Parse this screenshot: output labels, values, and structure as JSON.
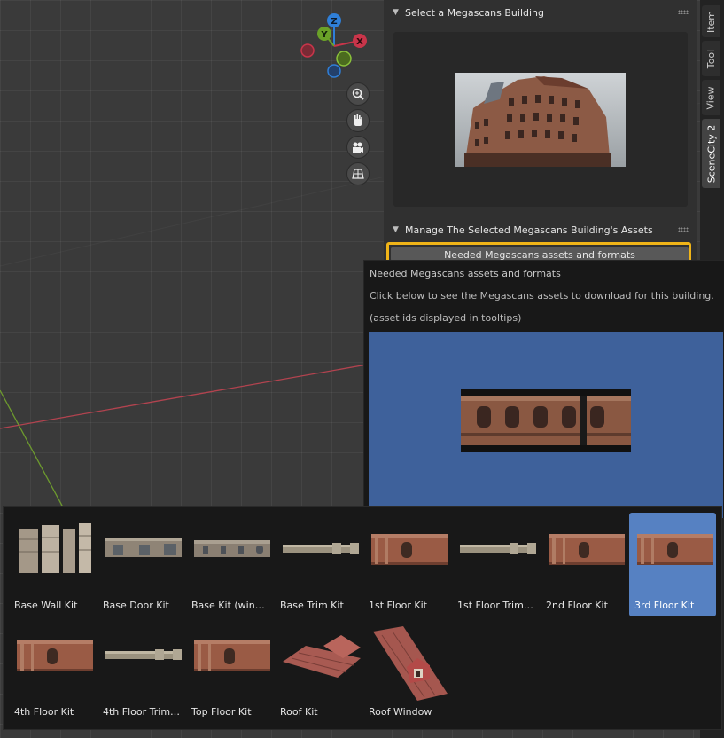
{
  "panel": {
    "section1_title": "Select a Megascans Building",
    "section2_title": "Manage The Selected Megascans Building's Assets",
    "button_label": "Needed Megascans assets and formats"
  },
  "tabs": [
    "Item",
    "Tool",
    "View",
    "SceneCity 2"
  ],
  "active_tab": "SceneCity 2",
  "tooltip": {
    "title": "Needed Megascans assets and formats",
    "description": "Click below to see the Megascans assets to download for this building.",
    "note": "(asset ids displayed in tooltips)"
  },
  "gizmo": {
    "z": "Z",
    "y": "Y",
    "x": "X"
  },
  "assets": [
    {
      "label": "Base Wall Kit",
      "icon": "wall-kit-thumbnail",
      "selected": false
    },
    {
      "label": "Base Door Kit",
      "icon": "door-kit-thumbnail",
      "selected": false
    },
    {
      "label": "Base Kit (wind…",
      "icon": "window-kit-thumbnail",
      "selected": false
    },
    {
      "label": "Base Trim Kit",
      "icon": "trim-kit-thumbnail",
      "selected": false
    },
    {
      "label": "1st Floor Kit",
      "icon": "floor-kit-thumbnail",
      "selected": false
    },
    {
      "label": "1st Floor Trim Kit",
      "icon": "trim-kit-thumbnail",
      "selected": false
    },
    {
      "label": "2nd Floor Kit",
      "icon": "floor-kit-thumbnail",
      "selected": false
    },
    {
      "label": "3rd Floor Kit",
      "icon": "floor-kit-thumbnail",
      "selected": true
    },
    {
      "label": "4th Floor Kit",
      "icon": "floor-kit-thumbnail",
      "selected": false
    },
    {
      "label": "4th Floor Trim …",
      "icon": "trim-kit-thumbnail",
      "selected": false
    },
    {
      "label": "Top Floor Kit",
      "icon": "floor-kit-thumbnail",
      "selected": false
    },
    {
      "label": "Roof Kit",
      "icon": "roof-kit-thumbnail",
      "selected": false
    },
    {
      "label": "Roof Window",
      "icon": "roof-window-thumbnail",
      "selected": false
    }
  ],
  "colors": {
    "accent_highlight": "#f0b418",
    "selected": "#5681c2",
    "tooltip_preview": "#3e619b",
    "x_axis": "#c9354a",
    "y_axis": "#6aa128",
    "z_axis": "#2f7fd8"
  }
}
